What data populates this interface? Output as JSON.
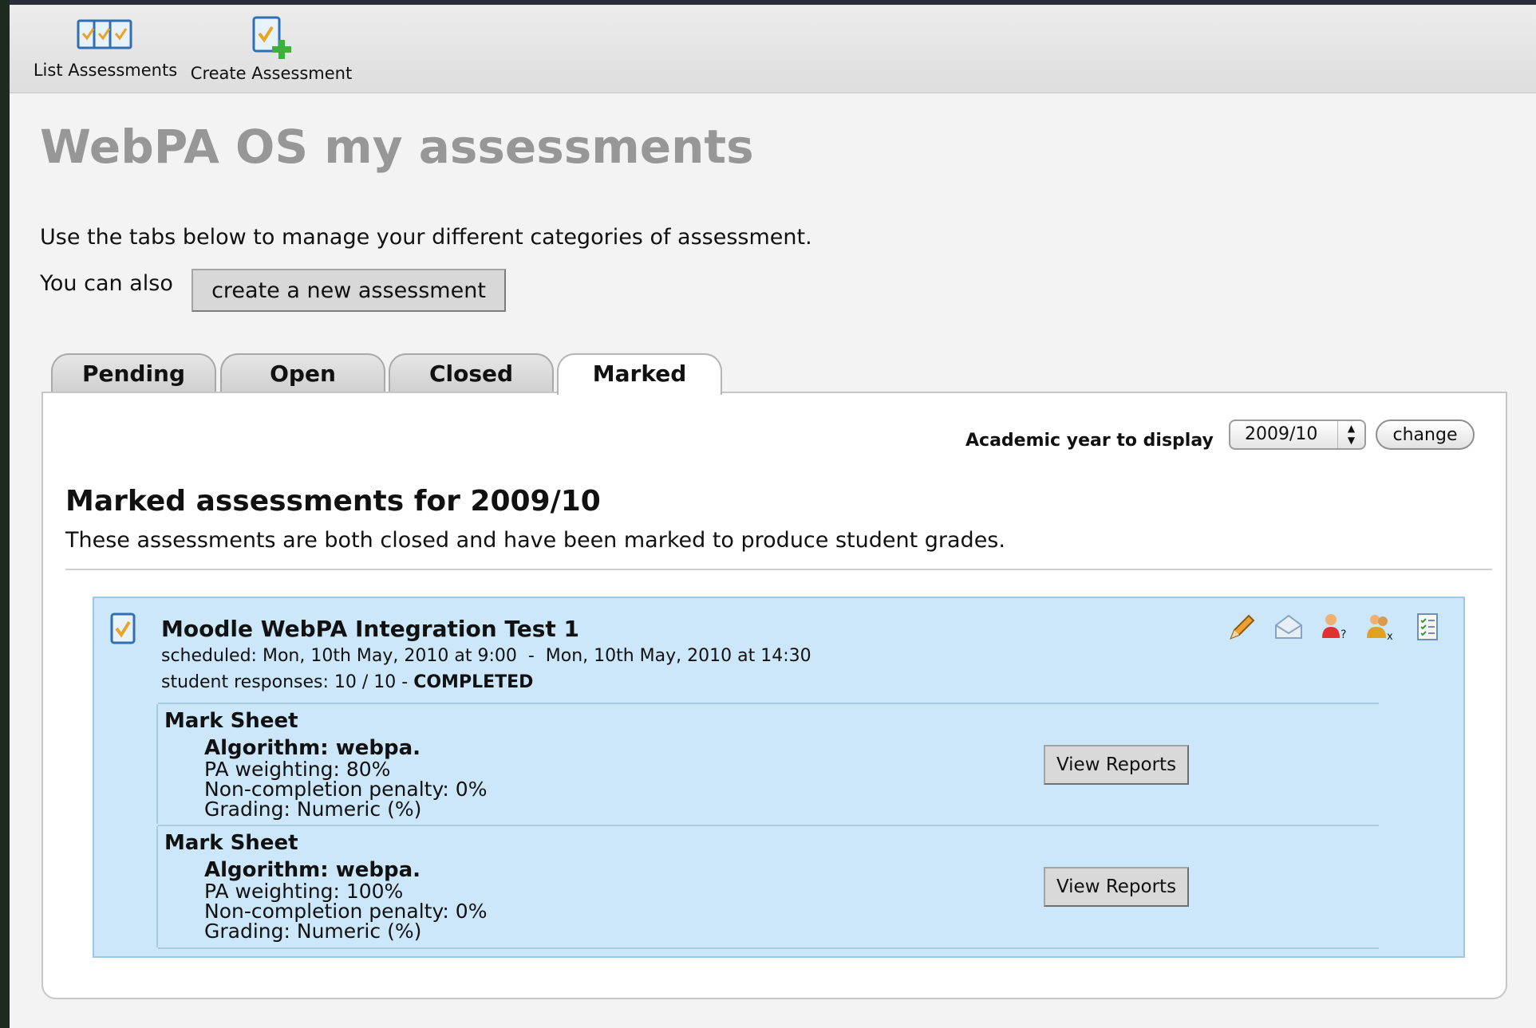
{
  "toolbar": {
    "items": [
      {
        "label": "List Assessments",
        "icon": "list-assessments-icon"
      },
      {
        "label": "Create Assessment",
        "icon": "create-assessment-icon"
      }
    ]
  },
  "page": {
    "title": "WebPA OS my assessments",
    "intro": "Use the tabs below to manage your different categories of assessment.",
    "also_text": "You can also",
    "create_button": "create a new assessment"
  },
  "tabs": [
    {
      "label": "Pending",
      "active": false
    },
    {
      "label": "Open",
      "active": false
    },
    {
      "label": "Closed",
      "active": false
    },
    {
      "label": "Marked",
      "active": true
    }
  ],
  "year_filter": {
    "label": "Academic year to display",
    "selected": "2009/10",
    "change_button": "change"
  },
  "section": {
    "title": "Marked assessments for 2009/10",
    "description": "These assessments are both closed and have been marked to produce student grades."
  },
  "assessment": {
    "title": "Moodle WebPA Integration Test 1",
    "scheduled": "scheduled: Mon, 10th May, 2010 at 9:00  -  Mon, 10th May, 2010 at 14:30",
    "responses_prefix": "student responses: 10 / 10 - ",
    "responses_status": "COMPLETED",
    "action_icons": [
      "edit-pencil-icon",
      "email-envelope-icon",
      "student-query-icon",
      "remove-student-icon",
      "checklist-report-icon"
    ],
    "mark_sheets": [
      {
        "title": "Mark Sheet",
        "algorithm": "Algorithm: webpa.",
        "pa_weighting": "PA weighting: 80%",
        "penalty": "Non-completion penalty: 0%",
        "grading": "Grading: Numeric (%)",
        "button": "View Reports"
      },
      {
        "title": "Mark Sheet",
        "algorithm": "Algorithm: webpa.",
        "pa_weighting": "PA weighting: 100%",
        "penalty": "Non-completion penalty: 0%",
        "grading": "Grading: Numeric (%)",
        "button": "View Reports"
      }
    ]
  },
  "colors": {
    "title_gray": "#979797",
    "assessment_bg": "#cbe7f9",
    "panel_bg": "#ffffff"
  }
}
